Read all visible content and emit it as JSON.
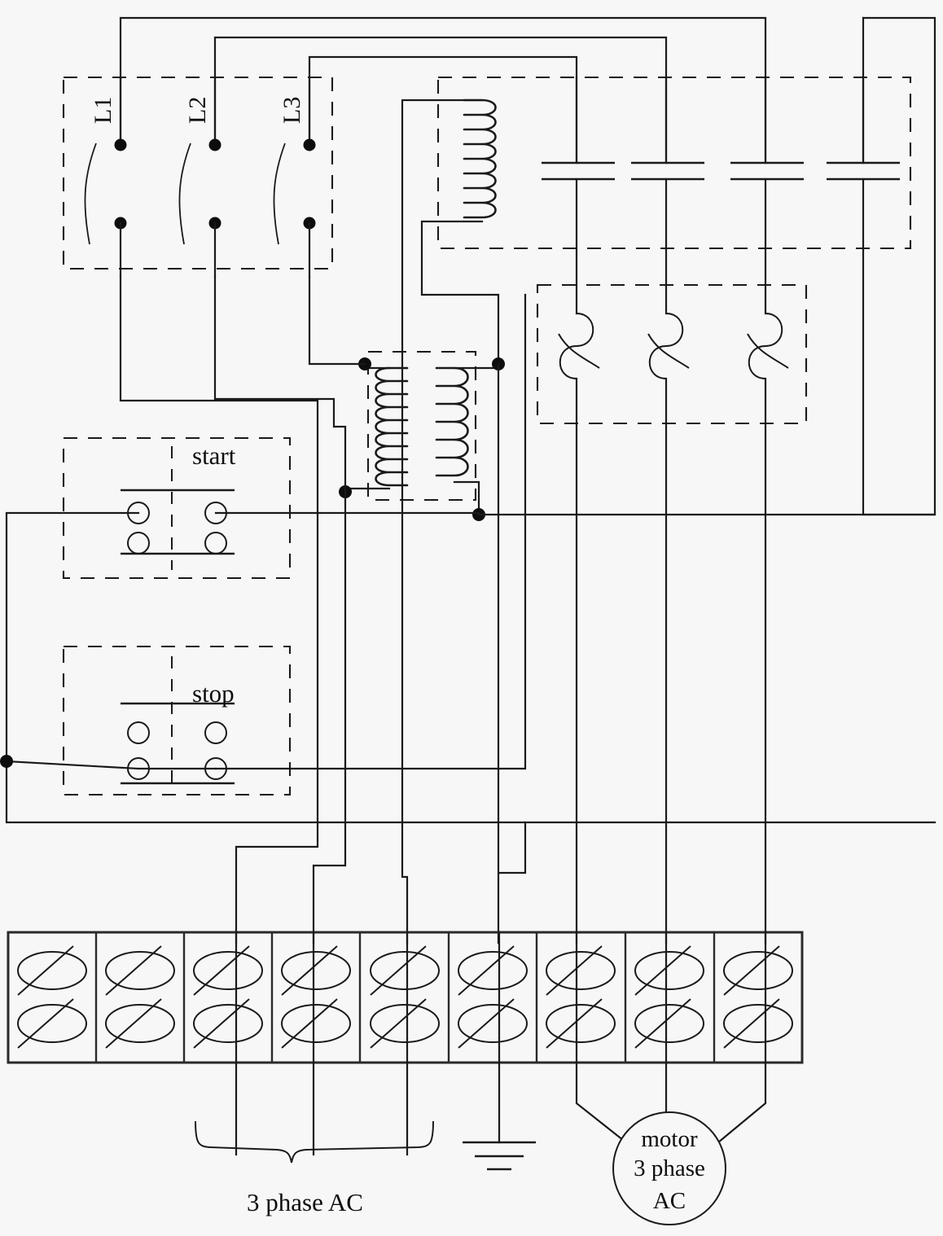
{
  "diagram": {
    "title": "Three-phase motor starter wiring diagram",
    "line_color": "#1a1a1a",
    "background": "#f7f7f7"
  },
  "disconnect": {
    "name": "three-pole disconnect switch",
    "poles": [
      {
        "label": "L1"
      },
      {
        "label": "L2"
      },
      {
        "label": "L3"
      }
    ]
  },
  "contactor": {
    "name": "contactor",
    "coil_label": "",
    "contact_count": 4
  },
  "overload_relay": {
    "name": "overload relay",
    "element_count": 3
  },
  "control_transformer": {
    "name": "control transformer",
    "primary_label": "",
    "secondary_label": ""
  },
  "pushbuttons": [
    {
      "id": "start",
      "label": "start"
    },
    {
      "id": "stop",
      "label": "stop"
    }
  ],
  "terminal_block": {
    "name": "terminal block",
    "slot_count": 9,
    "slots": [
      {
        "index": 1,
        "wired": false
      },
      {
        "index": 2,
        "wired": false
      },
      {
        "index": 3,
        "wired": true
      },
      {
        "index": 4,
        "wired": true
      },
      {
        "index": 5,
        "wired": true
      },
      {
        "index": 6,
        "wired": true
      },
      {
        "index": 7,
        "wired": true
      },
      {
        "index": 8,
        "wired": true
      },
      {
        "index": 9,
        "wired": true
      }
    ]
  },
  "annotations": {
    "supply_brace_label": "3 phase AC",
    "ground_label": "",
    "motor_line1": "motor",
    "motor_line2": "3 phase",
    "motor_line3": "AC"
  }
}
